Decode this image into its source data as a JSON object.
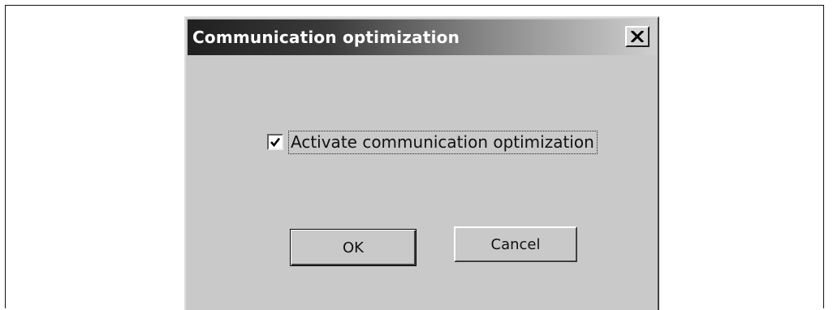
{
  "dialog": {
    "title": "Communication optimization",
    "close_icon": "close-x-icon"
  },
  "checkbox": {
    "label": "Activate communication optimization",
    "checked": true,
    "check_icon": "checkmark-icon"
  },
  "buttons": {
    "ok_label": "OK",
    "cancel_label": "Cancel"
  },
  "colors": {
    "dialog_face": "#c9c9c9",
    "titlebar_start": "#202020",
    "titlebar_end": "#cfcfcf",
    "title_text": "#ffffff"
  }
}
